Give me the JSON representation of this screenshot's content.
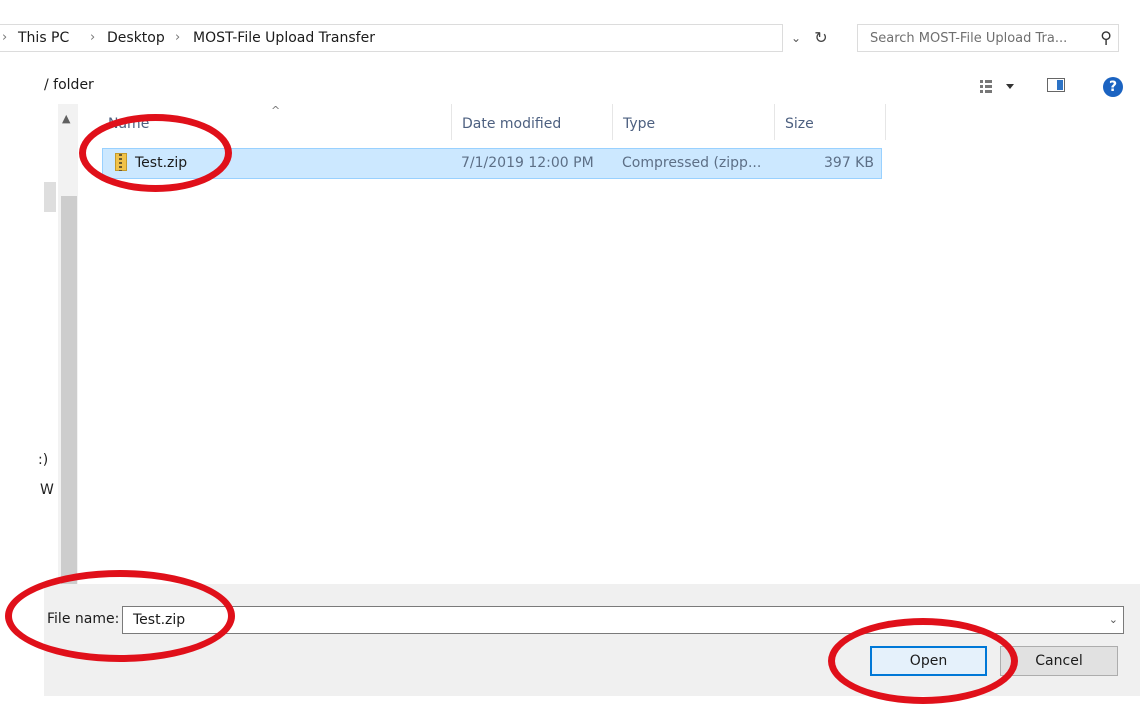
{
  "address_bar": {
    "lead_separator": "›",
    "crumbs": [
      "This PC",
      "Desktop",
      "MOST-File Upload Transfer"
    ],
    "separator": "›",
    "history_icon": "chevron-down-icon",
    "refresh_icon": "refresh-icon"
  },
  "search": {
    "placeholder": "Search MOST-File Upload Tra...",
    "icon": "search-icon"
  },
  "toolbar": {
    "new_folder_label": "/ folder",
    "view_icon": "view-options-icon",
    "preview_icon": "preview-pane-icon",
    "help_label": "?"
  },
  "nav": {
    "fragment_1": ":)",
    "fragment_2": "W"
  },
  "columns": {
    "name": "Name",
    "date": "Date modified",
    "type": "Type",
    "size": "Size"
  },
  "files": [
    {
      "name": "Test.zip",
      "date": "7/1/2019 12:00 PM",
      "type": "Compressed (zipp...",
      "size": "397 KB",
      "selected": true
    }
  ],
  "filename": {
    "label": "File name:",
    "value": "Test.zip"
  },
  "buttons": {
    "open": "Open",
    "cancel": "Cancel"
  },
  "highlight_color": "#e0101a",
  "selection_color": "#cce8ff",
  "accent_color": "#0078d7"
}
